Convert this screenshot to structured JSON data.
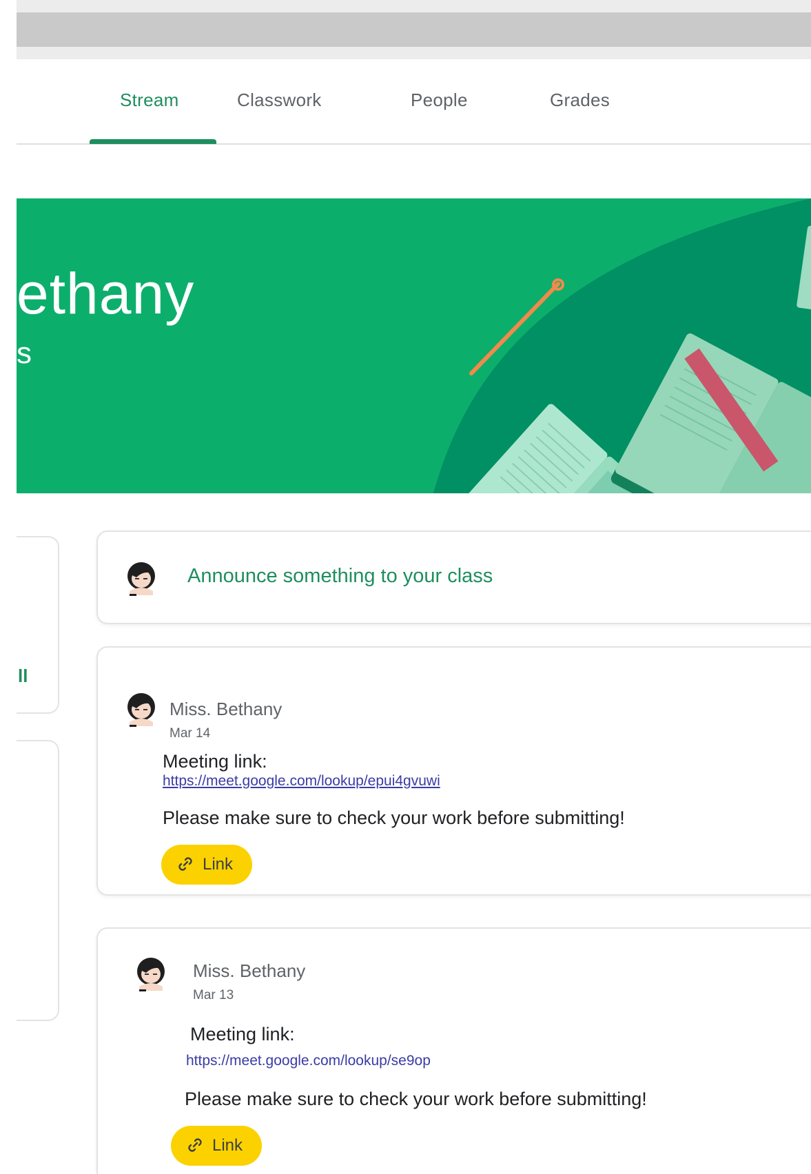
{
  "tabs": [
    {
      "label": "Stream",
      "active": true
    },
    {
      "label": "Classwork",
      "active": false
    },
    {
      "label": "People",
      "active": false
    },
    {
      "label": "Grades",
      "active": false
    }
  ],
  "banner": {
    "title_fragment": "ethany",
    "subtitle_fragment": "s",
    "color": "#0cae6c"
  },
  "sidebar": {
    "fragment": "ll"
  },
  "announce": {
    "placeholder": "Announce something to your class"
  },
  "posts": [
    {
      "author": "Miss. Bethany",
      "date": "Mar 14",
      "meeting_label": "Meeting link:",
      "meeting_url": "https://meet.google.com/lookup/epui4gvuwi",
      "message": "Please make sure to check your work before submitting!",
      "chip_label": "Link",
      "chip_icon": "link-icon"
    },
    {
      "author": "Miss. Bethany",
      "date": "Mar 13",
      "meeting_label": "Meeting link:",
      "meeting_url": "https://meet.google.com/lookup/se9op",
      "message": "Please make sure to check your work before submitting!",
      "chip_label": "Link",
      "chip_icon": "link-icon"
    }
  ],
  "colors": {
    "accent": "#1e8e5e",
    "chip": "#fbd200",
    "link": "#3b3ba6"
  }
}
